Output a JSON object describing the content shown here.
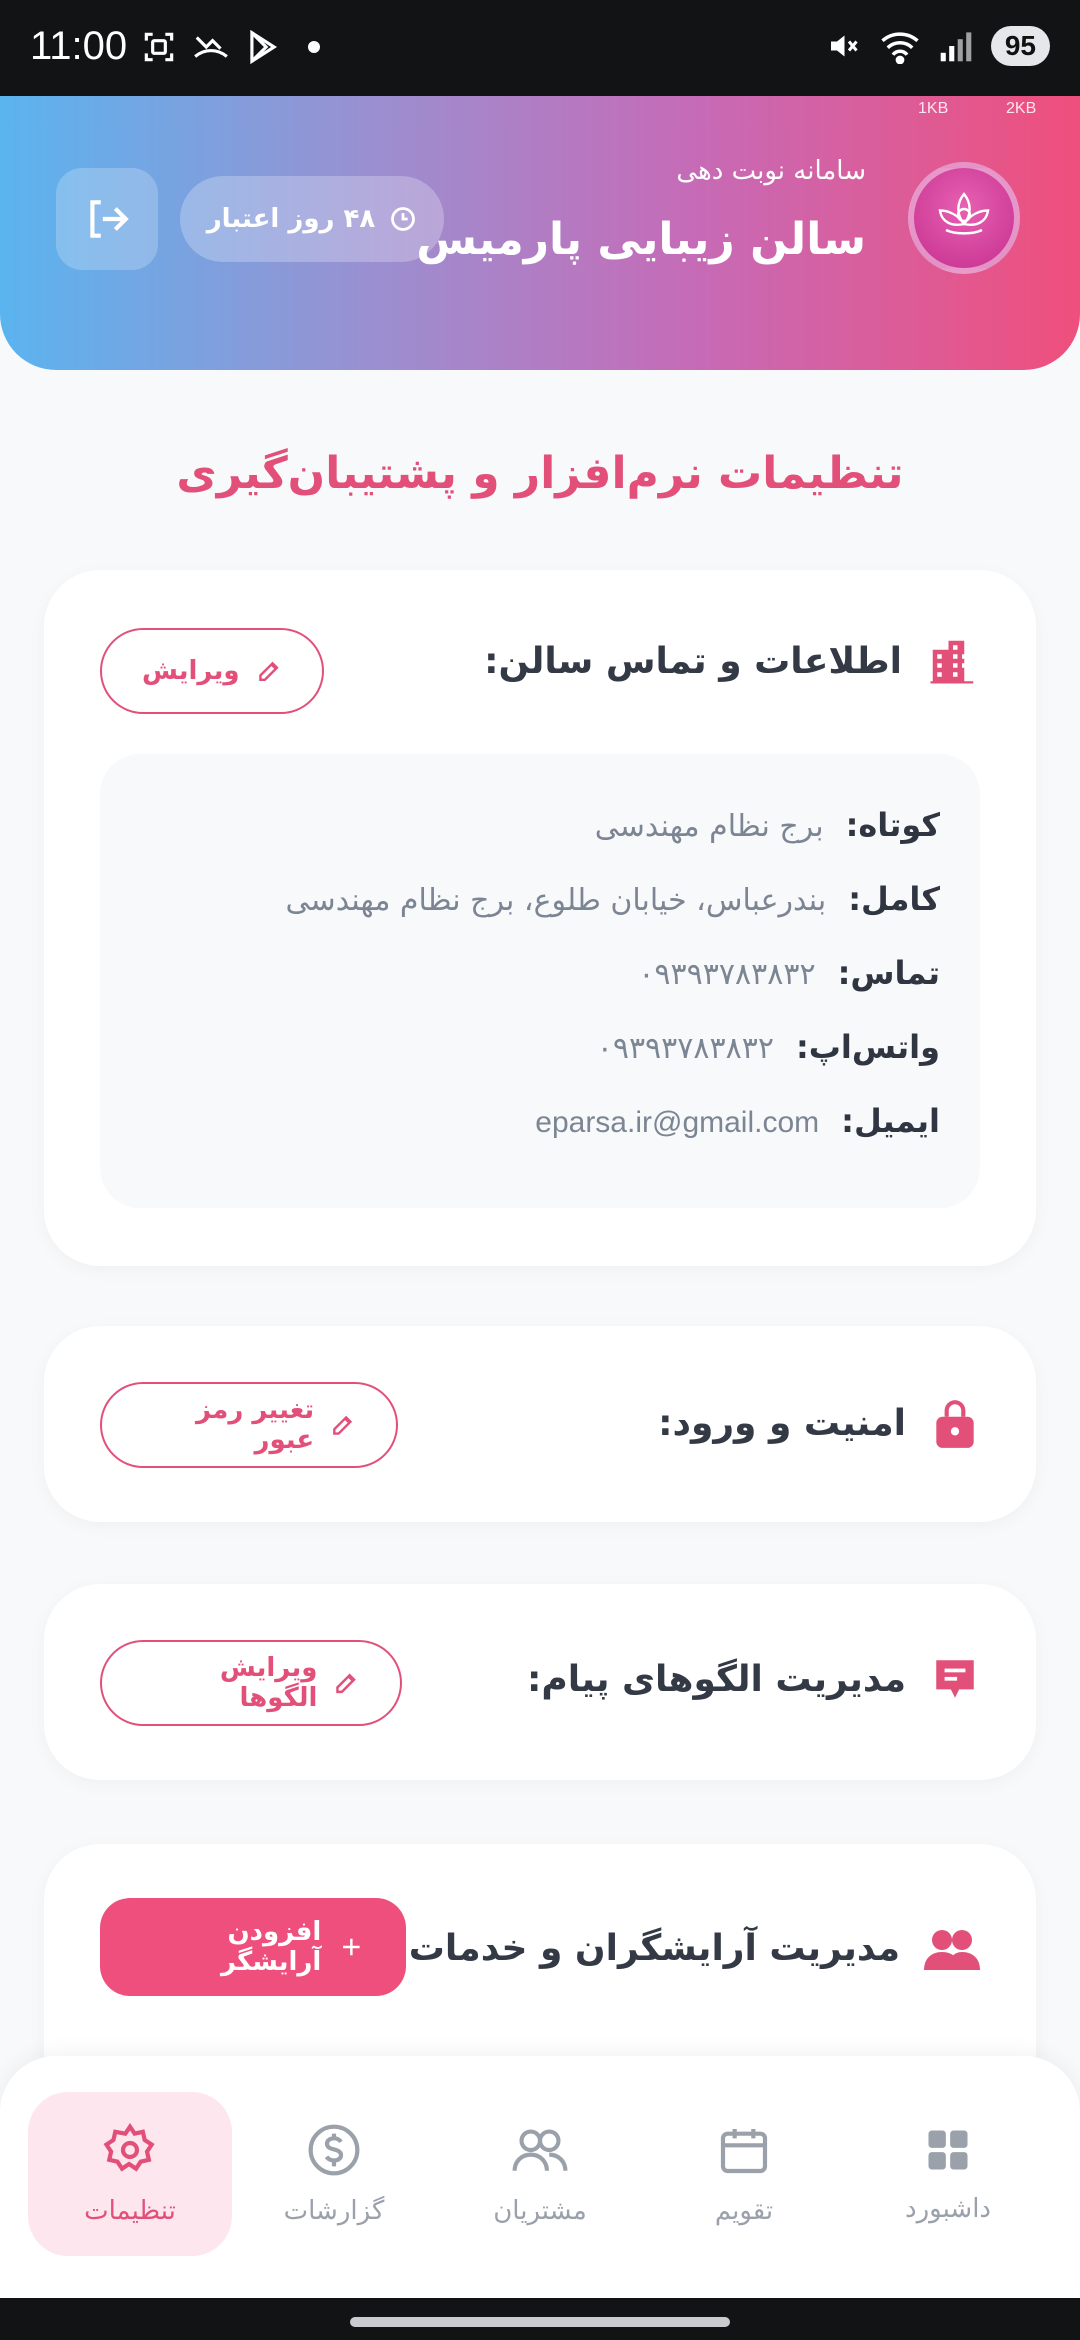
{
  "status_bar": {
    "time": "11:00",
    "battery": "95",
    "signal_label": "5"
  },
  "header": {
    "net_speed_1": "1KB",
    "net_speed_2": "2KB",
    "subtitle": "سامانه نوبت دهی",
    "salon_name": "سالن زیبایی پارمیس",
    "validity_label": "۴۸ روز اعتبار"
  },
  "page_title": "تنظیمات نرم‌افزار و پشتیبان‌گیری",
  "salon_info_card": {
    "title": "اطلاعات و تماس سالن:",
    "edit_label": "ویرایش",
    "rows": [
      {
        "label": "کوتاه:",
        "value": "برج نظام مهندسی"
      },
      {
        "label": "کامل:",
        "value": "بندرعباس، خیابان طلوع، برج نظام مهندسی"
      },
      {
        "label": "تماس:",
        "value": "۰۹۳۹۳۷۸۳۸۳۲"
      },
      {
        "label": "واتس‌اپ:",
        "value": "۰۹۳۹۳۷۸۳۸۳۲"
      },
      {
        "label": "ایمیل:",
        "value": "eparsa.ir@gmail.com"
      }
    ]
  },
  "security_card": {
    "title": "امنیت و ورود:",
    "button_label": "تغییر رمز عبور"
  },
  "templates_card": {
    "title": "مدیریت الگوهای پیام:",
    "button_label": "ویرایش الگوها"
  },
  "staff_card": {
    "title": "مدیریت آرایشگران و خدمات:",
    "button_label": "افزودن آرایشگر"
  },
  "bottom_nav": {
    "items": [
      {
        "label": "تنظیمات",
        "icon": "gear-icon"
      },
      {
        "label": "گزارشات",
        "icon": "dollar-icon"
      },
      {
        "label": "مشتریان",
        "icon": "users-icon"
      },
      {
        "label": "تقویم",
        "icon": "calendar-icon"
      },
      {
        "label": "داشبورد",
        "icon": "grid-icon"
      }
    ]
  },
  "colors": {
    "accent": "#ef4f7c",
    "accent_text": "#e2507a",
    "active_nav_bg": "#fde6ee"
  }
}
